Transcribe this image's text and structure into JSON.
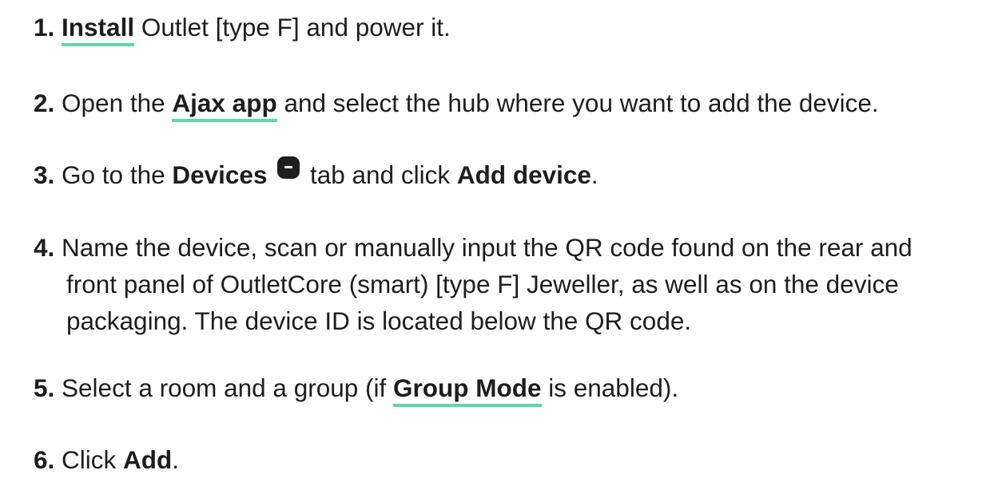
{
  "steps": [
    {
      "num": "1.",
      "link": "Install",
      "rest": " Outlet [type F] and power it."
    },
    {
      "num": "2.",
      "pre": " Open the ",
      "link": "Ajax app",
      "rest": " and select the hub where you want to add the device."
    },
    {
      "num": "3.",
      "pre": " Go to the ",
      "bold1": "Devices",
      "icon": "devices-tab-icon",
      "mid": " tab and click ",
      "bold2": "Add device",
      "end": "."
    },
    {
      "num": "4.",
      "line1": " Name the device, scan or manually input the QR code found on the rear and",
      "line2": "front panel of OutletCore (smart) [type F] Jeweller, as well as on the device",
      "line3": "packaging. The device ID is located below the QR code."
    },
    {
      "num": "5.",
      "pre": " Select a room and a group (if ",
      "link": "Group Mode",
      "rest": " is enabled)."
    },
    {
      "num": "6.",
      "pre": " Click ",
      "bold1": "Add",
      "end": "."
    }
  ],
  "colors": {
    "text": "#1d1d1d",
    "link_underline": "#5fd6a9",
    "background": "#ffffff"
  }
}
